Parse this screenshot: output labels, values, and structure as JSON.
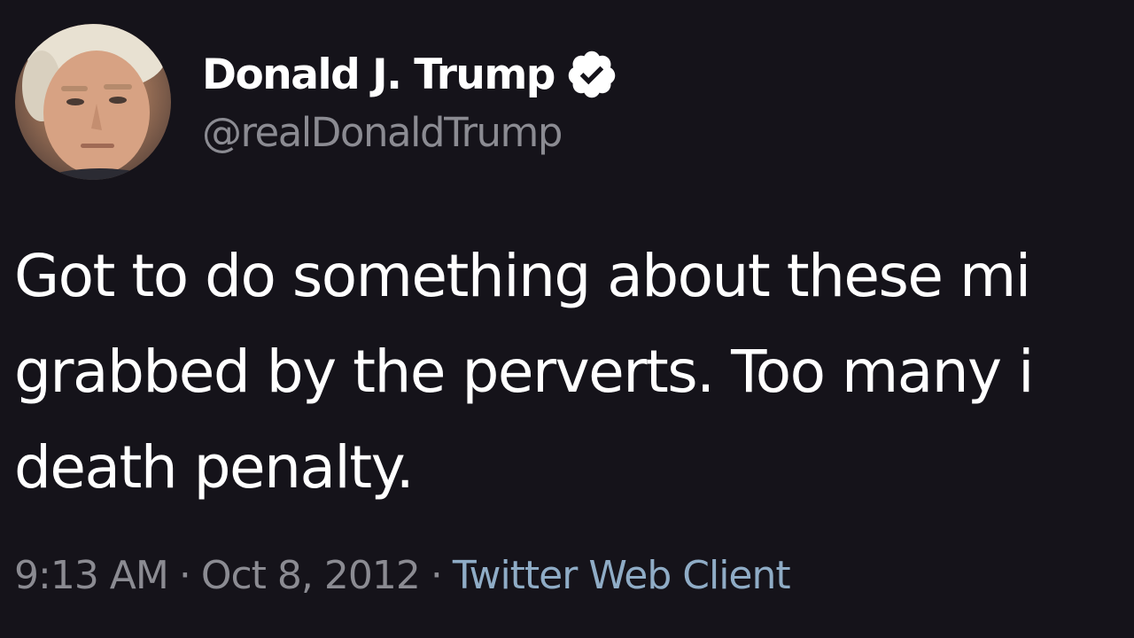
{
  "tweet": {
    "display_name": "Donald J. Trump",
    "handle": "@realDonaldTrump",
    "verified_icon": "verified-badge-icon",
    "text_lines": [
      "Got to do something about these mi",
      "grabbed by the perverts. Too many i",
      "death penalty."
    ],
    "time": "9:13 AM",
    "date": "Oct 8, 2012",
    "separator": "·",
    "source": "Twitter Web Client"
  },
  "colors": {
    "background": "#15131a",
    "text": "#ffffff",
    "secondary": "#8b8b92",
    "source_link": "#8facc6"
  }
}
